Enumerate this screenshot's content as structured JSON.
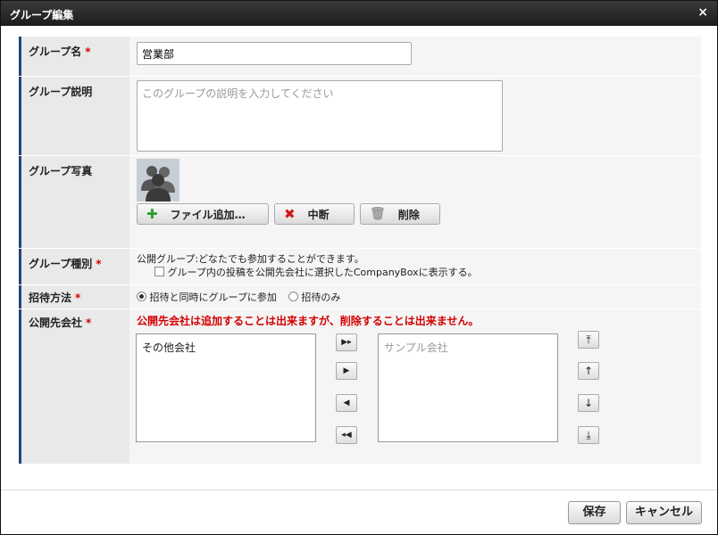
{
  "dialog": {
    "title": "グループ編集",
    "close_icon": "×"
  },
  "colors": {
    "accent_border": "#23457e",
    "required": "#d40000",
    "warning_text": "#d40000",
    "add_icon": "#2aa02a",
    "cancel_icon": "#d01818"
  },
  "form": {
    "group_name": {
      "label": "グループ名",
      "required_mark": "*",
      "value": "営業部"
    },
    "group_description": {
      "label": "グループ説明",
      "placeholder": "このグループの説明を入力してください",
      "value": ""
    },
    "group_photo": {
      "label": "グループ写真",
      "add_button": {
        "label": "ファイル追加…",
        "icon": "plus-icon"
      },
      "cancel_button": {
        "label": "中断",
        "icon": "x-icon"
      },
      "delete_button": {
        "label": "削除",
        "icon": "trash-icon"
      }
    },
    "group_type": {
      "label": "グループ種別",
      "required_mark": "*",
      "description": "公開グループ:どなたでも参加することができます。",
      "checkbox_label": "グループ内の投稿を公開先会社に選択したCompanyBoxに表示する。",
      "checkbox_checked": false
    },
    "invite_method": {
      "label": "招待方法",
      "required_mark": "*",
      "options": [
        {
          "label": "招待と同時にグループに参加",
          "selected": true
        },
        {
          "label": "招待のみ",
          "selected": false
        }
      ]
    },
    "public_companies": {
      "label": "公開先会社",
      "required_mark": "*",
      "warning": "公開先会社は追加することは出来ますが、削除することは出来ません。",
      "available_list": [
        "その他会社"
      ],
      "selected_list": [
        "サンプル会社"
      ],
      "move_buttons": [
        {
          "name": "move-all-right-button",
          "glyph": "▶▸"
        },
        {
          "name": "move-right-button",
          "glyph": "▶"
        },
        {
          "name": "move-left-button",
          "glyph": "◀"
        },
        {
          "name": "move-all-left-button",
          "glyph": "◂◀"
        }
      ],
      "order_buttons": [
        {
          "name": "move-top-button",
          "glyph": "⤒"
        },
        {
          "name": "move-up-button",
          "glyph": "↑"
        },
        {
          "name": "move-down-button",
          "glyph": "↓"
        },
        {
          "name": "move-bottom-button",
          "glyph": "⤓"
        }
      ]
    }
  },
  "footer": {
    "save_label": "保存",
    "cancel_label": "キャンセル"
  }
}
